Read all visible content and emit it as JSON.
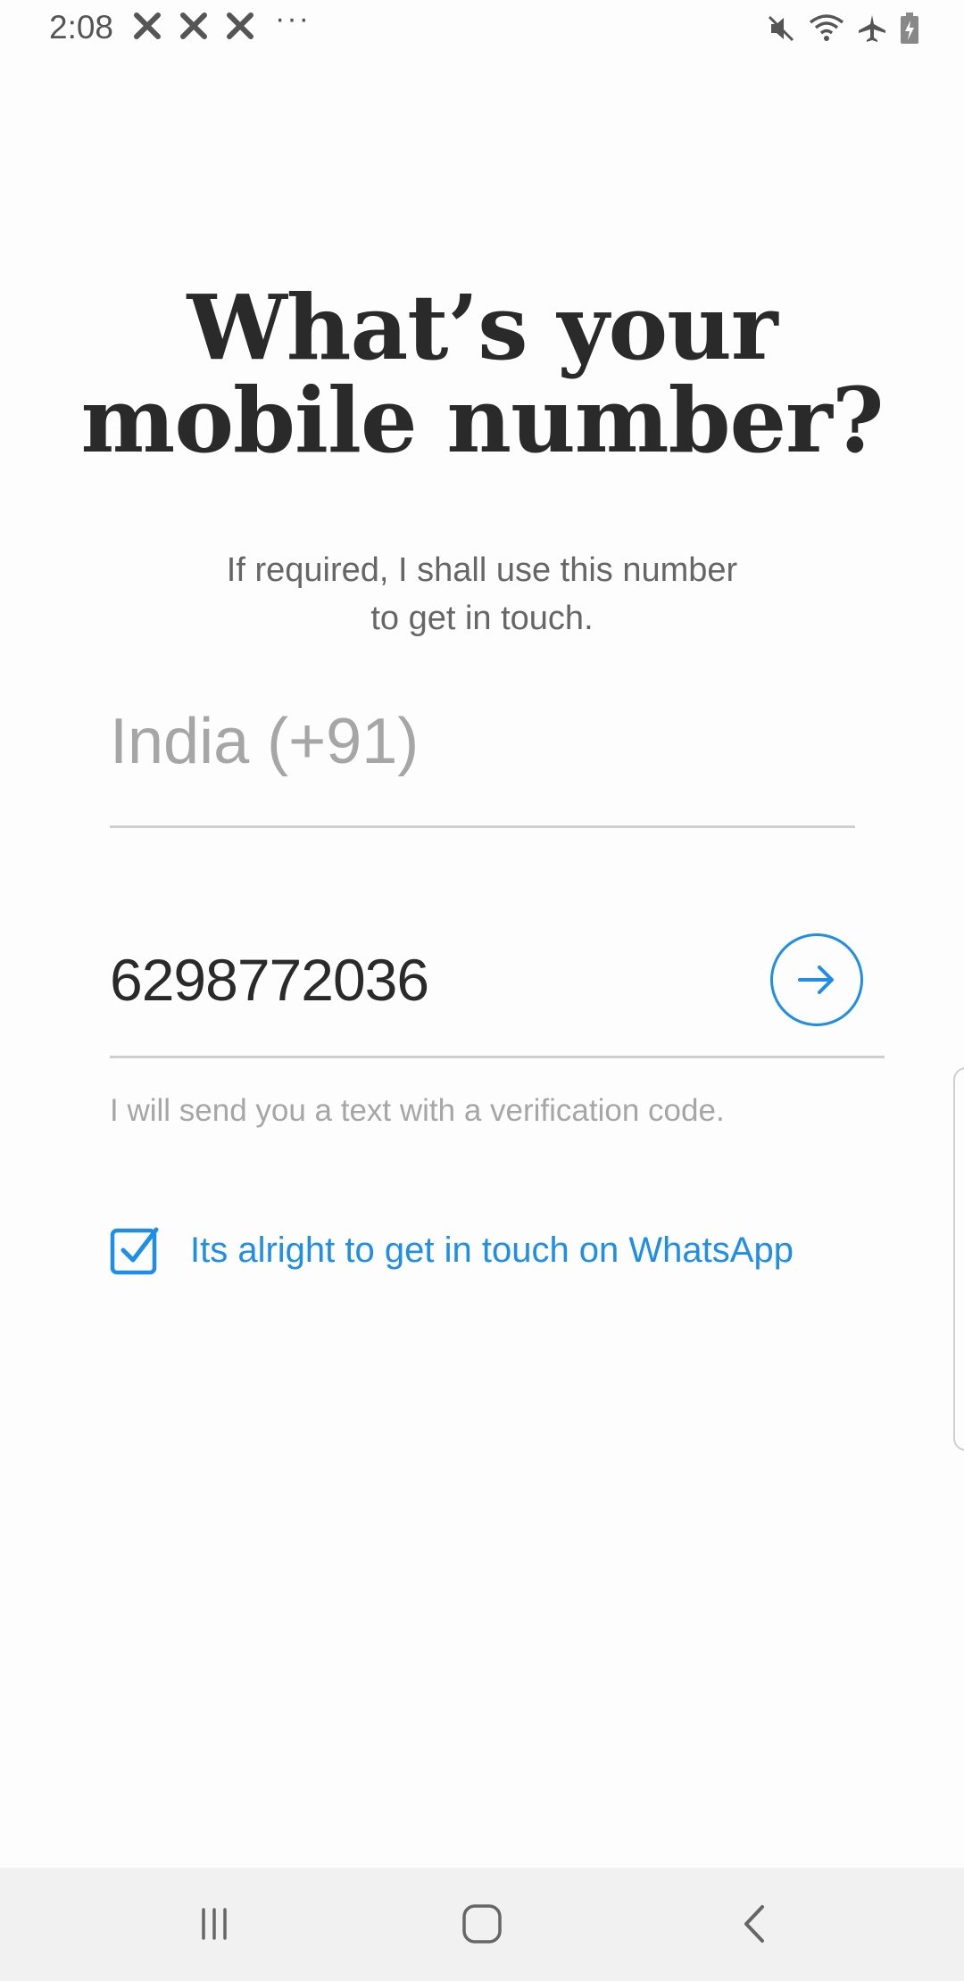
{
  "status_bar": {
    "time": "2:08",
    "left_icons": [
      "x-notification-icon",
      "x-notification-icon",
      "x-notification-icon"
    ],
    "more_indicator": "···",
    "right_icons": [
      "mute-icon",
      "wifi-icon",
      "airplane-mode-icon",
      "battery-charging-icon"
    ]
  },
  "screen": {
    "title_line1": "What’s your",
    "title_line2": "mobile number?",
    "subtitle_line1": "If required, I shall use this number",
    "subtitle_line2": "to get in touch."
  },
  "form": {
    "country": "India (+91)",
    "phone_number": "6298772036",
    "next_icon": "arrow-right-icon",
    "helper_text": "I will send you a text with a verification code.",
    "whatsapp_checkbox": {
      "label": "Its alright to get in touch on WhatsApp",
      "checked": true
    }
  },
  "colors": {
    "accent": "#1e8ee6",
    "title": "#2a2a2a",
    "muted": "#a6a6a6",
    "nav_bar": "#f1f1f1"
  },
  "nav_bar": {
    "buttons": [
      "recent-apps-icon",
      "home-icon",
      "back-icon"
    ]
  }
}
